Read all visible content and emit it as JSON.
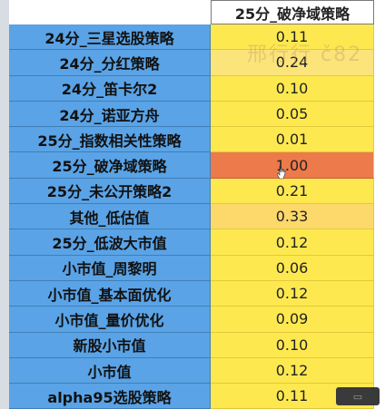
{
  "table": {
    "header": "25分_破净域策略",
    "rows": [
      {
        "label": "24分_三星选股策略",
        "value": "0.11"
      },
      {
        "label": "24分_分红策略",
        "value": "0.24"
      },
      {
        "label": "24分_笛卡尔2",
        "value": "0.10"
      },
      {
        "label": "24分_诺亚方舟",
        "value": "0.05"
      },
      {
        "label": "25分_指数相关性策略",
        "value": "0.01"
      },
      {
        "label": "25分_破净域策略",
        "value": "1.00"
      },
      {
        "label": "25分_未公开策略2",
        "value": "0.21"
      },
      {
        "label": "其他_低估值",
        "value": "0.33"
      },
      {
        "label": "25分_低波大市值",
        "value": "0.12"
      },
      {
        "label": "小市值_周黎明",
        "value": "0.06"
      },
      {
        "label": "小市值_基本面优化",
        "value": "0.12"
      },
      {
        "label": "小市值_量价优化",
        "value": "0.09"
      },
      {
        "label": "新股小市值",
        "value": "0.10"
      },
      {
        "label": "小市值",
        "value": "0.12"
      },
      {
        "label": "alpha95选股策略",
        "value": "0.11"
      }
    ]
  },
  "watermark": "邢行行 č82",
  "colors": {
    "label_bg": "#5aa3e6",
    "value_bg": "#fde94f",
    "max_bg": "#ec7a4a"
  }
}
